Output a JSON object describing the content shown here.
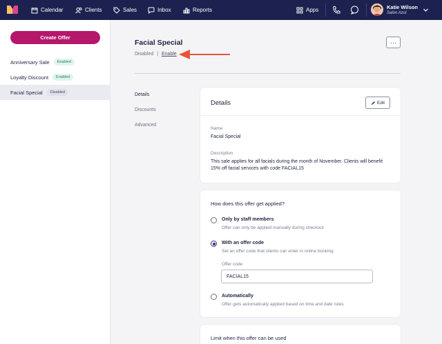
{
  "topbar": {
    "nav": [
      {
        "label": "Calendar",
        "icon": "calendar-icon"
      },
      {
        "label": "Clients",
        "icon": "users-icon"
      },
      {
        "label": "Sales",
        "icon": "tag-icon"
      },
      {
        "label": "Inbox",
        "icon": "chat-icon"
      },
      {
        "label": "Reports",
        "icon": "bar-chart-icon"
      }
    ],
    "apps_label": "Apps",
    "user_name": "Katie Wilson",
    "user_sub": "Salon Azul"
  },
  "sidebar": {
    "create_label": "Create Offer",
    "items": [
      {
        "label": "Anniversary Sale",
        "status": "Enabled"
      },
      {
        "label": "Loyalty Discount",
        "status": "Enabled"
      },
      {
        "label": "Facial Special",
        "status": "Disabled"
      }
    ]
  },
  "header": {
    "title": "Facial Special",
    "status": "Disabled",
    "separator": "|",
    "enable_label": "Enable",
    "more_label": "···"
  },
  "tabs": [
    "Details",
    "Discounts",
    "Advanced"
  ],
  "details_card": {
    "title": "Details",
    "edit_label": "Edit",
    "name_label": "Name",
    "name_value": "Facial Special",
    "description_label": "Description",
    "description_value": "This sale applies for all facials during the month of November. Clients will benefit 15% off facial services with code FACIAL15"
  },
  "apply_card": {
    "question": "How does this offer get applied?",
    "options": [
      {
        "title": "Only by staff members",
        "desc": "Offer can only be applied manually during checkout"
      },
      {
        "title": "With an offer code",
        "desc": "Set an offer code that clients can enter in online booking"
      },
      {
        "title": "Automatically",
        "desc": "Offer gets automatically applied based on time and date rules"
      }
    ],
    "selected_index": 1,
    "code_label": "Offer code",
    "code_value": "FACIAL15"
  },
  "limit_card": {
    "title": "Limit when this offer can be used"
  },
  "colors": {
    "topbar": "#1d2150",
    "accent": "#b5176b",
    "arrow": "#e8523a"
  }
}
